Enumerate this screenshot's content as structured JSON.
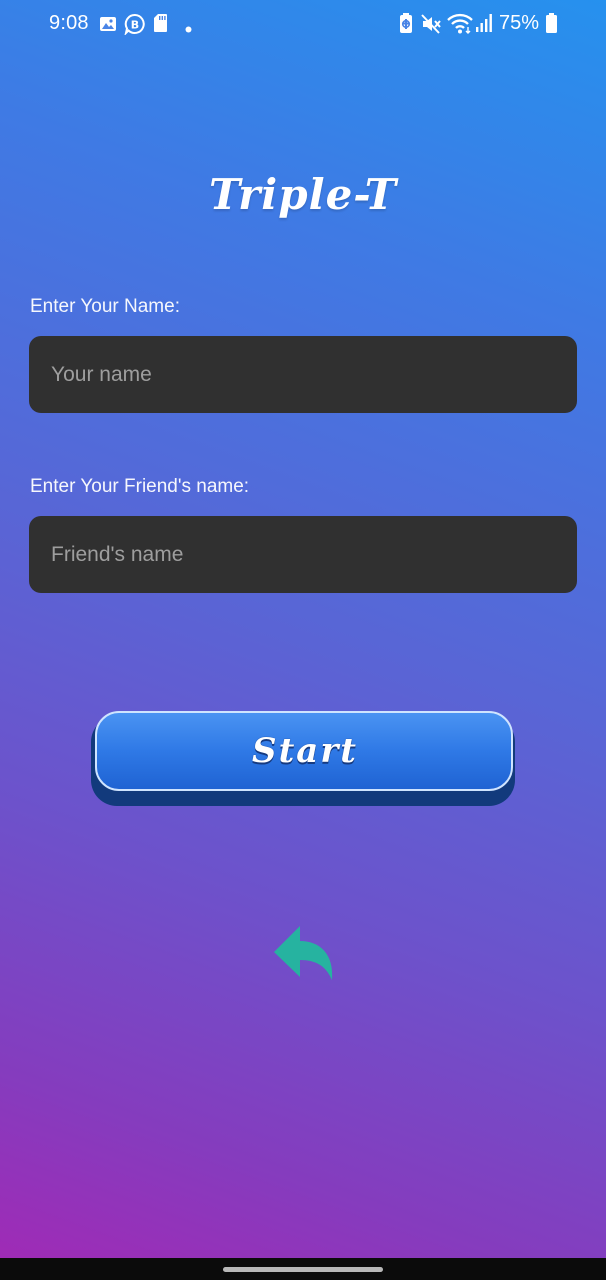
{
  "status_bar": {
    "time": "9:08",
    "battery_percent": "75%",
    "left_icons": [
      "gallery-icon",
      "business-chat-icon",
      "sd-card-icon",
      "dot-icon"
    ],
    "right_icons": [
      "battery-saver-icon",
      "mute-icon",
      "wifi-icon",
      "signal-icon",
      "battery-icon"
    ]
  },
  "app": {
    "title": "Triple-T"
  },
  "form": {
    "name_label": "Enter Your Name:",
    "name_placeholder": "Your name",
    "name_value": "",
    "friend_label": "Enter Your Friend's name:",
    "friend_placeholder": "Friend's name",
    "friend_value": ""
  },
  "actions": {
    "start_label": "Start",
    "back_icon": "back-arrow-icon"
  },
  "colors": {
    "gradient_top": "#2691ee",
    "gradient_bottom": "#a229b5",
    "field_background": "#303030",
    "start_button": "#2f79e6",
    "back_arrow": "#26b3a0"
  }
}
